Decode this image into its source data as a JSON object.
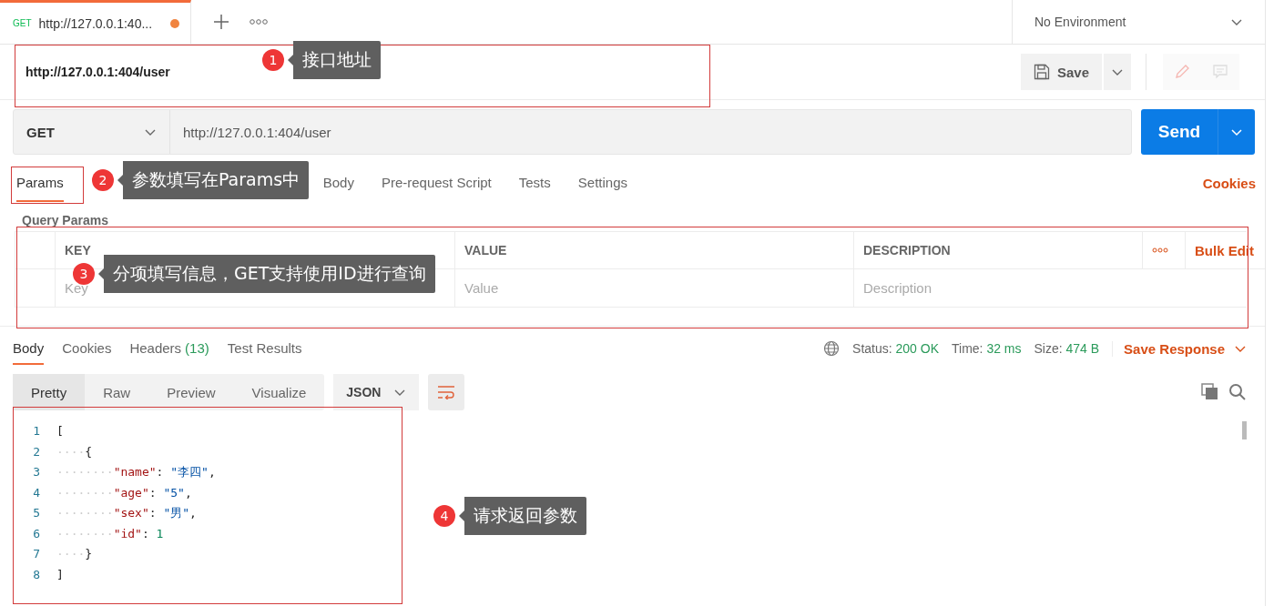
{
  "tab_bar": {
    "tab": {
      "method": "GET",
      "title": "http://127.0.0.1:40...",
      "unsaved": true
    },
    "environment": "No Environment"
  },
  "request_name": "http://127.0.0.1:404/user",
  "save_button": "Save",
  "request": {
    "method": "GET",
    "url": "http://127.0.0.1:404/user",
    "send": "Send"
  },
  "request_tabs": [
    {
      "label": "Params",
      "selected": true
    },
    {
      "label": "Body",
      "selected": false
    },
    {
      "label": "Pre-request Script",
      "selected": false
    },
    {
      "label": "Tests",
      "selected": false
    },
    {
      "label": "Settings",
      "selected": false
    }
  ],
  "cookies_link": "Cookies",
  "query_params": {
    "title": "Query Params",
    "columns": [
      "KEY",
      "VALUE",
      "DESCRIPTION"
    ],
    "bulk_edit": "Bulk Edit",
    "placeholders": [
      "Key",
      "Value",
      "Description"
    ]
  },
  "response_tabs": [
    {
      "label": "Body",
      "selected": true
    },
    {
      "label": "Cookies",
      "selected": false
    },
    {
      "label": "Headers",
      "count": "(13)",
      "selected": false
    },
    {
      "label": "Test Results",
      "selected": false
    }
  ],
  "status": [
    {
      "label": "Status:",
      "value": "200 OK"
    },
    {
      "label": "Time:",
      "value": "32 ms"
    },
    {
      "label": "Size:",
      "value": "474 B"
    }
  ],
  "save_response": "Save Response",
  "view_modes": [
    {
      "label": "Pretty",
      "selected": true
    },
    {
      "label": "Raw",
      "selected": false
    },
    {
      "label": "Preview",
      "selected": false
    },
    {
      "label": "Visualize",
      "selected": false
    }
  ],
  "format": "JSON",
  "code_lines": [
    {
      "number": "1",
      "tokens": [
        {
          "kind": "bracket",
          "text": "["
        }
      ]
    },
    {
      "number": "2",
      "tokens": [
        {
          "kind": "indent",
          "text": "····"
        },
        {
          "kind": "bracket",
          "text": "{"
        }
      ]
    },
    {
      "number": "3",
      "tokens": [
        {
          "kind": "indent",
          "text": "········"
        },
        {
          "kind": "key",
          "text": "\"name\""
        },
        {
          "kind": "punct",
          "text": ": "
        },
        {
          "kind": "string",
          "text": "\"李四\""
        },
        {
          "kind": "punct",
          "text": ","
        }
      ]
    },
    {
      "number": "4",
      "tokens": [
        {
          "kind": "indent",
          "text": "········"
        },
        {
          "kind": "key",
          "text": "\"age\""
        },
        {
          "kind": "punct",
          "text": ": "
        },
        {
          "kind": "string",
          "text": "\"5\""
        },
        {
          "kind": "punct",
          "text": ","
        }
      ]
    },
    {
      "number": "5",
      "tokens": [
        {
          "kind": "indent",
          "text": "········"
        },
        {
          "kind": "key",
          "text": "\"sex\""
        },
        {
          "kind": "punct",
          "text": ": "
        },
        {
          "kind": "string",
          "text": "\"男\""
        },
        {
          "kind": "punct",
          "text": ","
        }
      ]
    },
    {
      "number": "6",
      "tokens": [
        {
          "kind": "indent",
          "text": "········"
        },
        {
          "kind": "key",
          "text": "\"id\""
        },
        {
          "kind": "punct",
          "text": ": "
        },
        {
          "kind": "number",
          "text": "1"
        }
      ]
    },
    {
      "number": "7",
      "tokens": [
        {
          "kind": "indent",
          "text": "····"
        },
        {
          "kind": "bracket",
          "text": "}"
        }
      ]
    },
    {
      "number": "8",
      "tokens": [
        {
          "kind": "bracket",
          "text": "]"
        }
      ]
    }
  ],
  "annotations": [
    {
      "number": "1",
      "text": "接口地址"
    },
    {
      "number": "2",
      "text": "参数填写在Params中"
    },
    {
      "number": "3",
      "text": "分项填写信息，GET支持使用ID进行查询"
    },
    {
      "number": "4",
      "text": "请求返回参数"
    }
  ]
}
